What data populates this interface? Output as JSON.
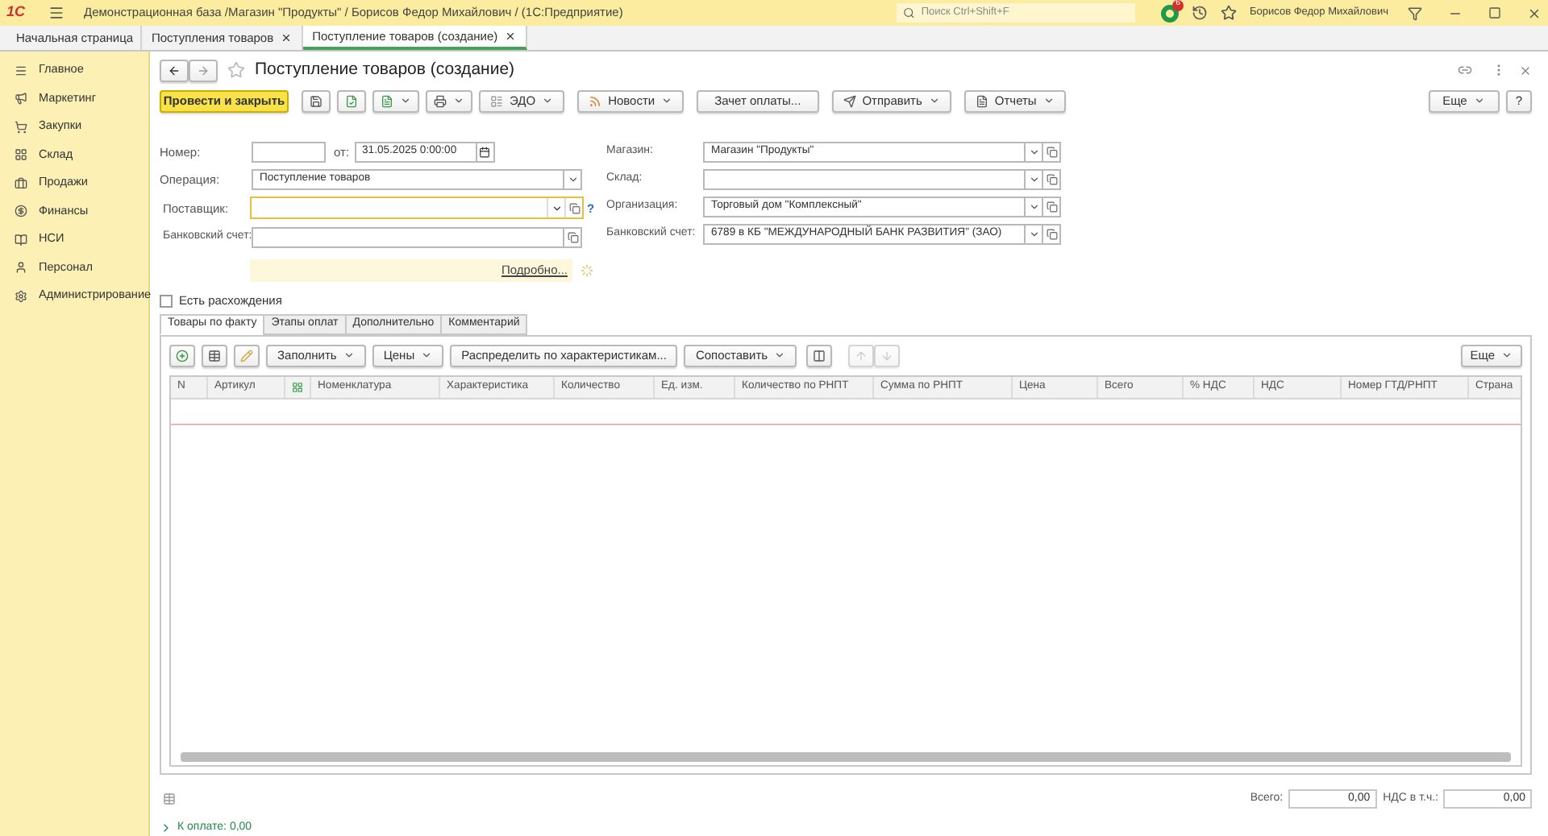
{
  "app_bar": {
    "logo": "1С",
    "title": "Демонстрационная база /Магазин \"Продукты\" / Борисов Федор Михайлович /  (1С:Предприятие)",
    "search_placeholder": "Поиск Ctrl+Shift+F",
    "notifications": "6",
    "user": "Борисов Федор Михайлович"
  },
  "open_tabs": [
    {
      "kind": "home",
      "label": "Начальная страница",
      "selected": false
    },
    {
      "kind": "closable",
      "label": "Поступления товаров",
      "selected": false
    },
    {
      "kind": "closable",
      "label": "Поступление товаров (создание)",
      "selected": true
    }
  ],
  "sidebar": {
    "items": [
      {
        "label": "Главное"
      },
      {
        "label": "Маркетинг"
      },
      {
        "label": "Закупки"
      },
      {
        "label": "Склад"
      },
      {
        "label": "Продажи"
      },
      {
        "label": "Финансы"
      },
      {
        "label": "НСИ"
      },
      {
        "label": "Персонал"
      },
      {
        "label": "Администрирование"
      }
    ]
  },
  "form": {
    "title": "Поступление товаров (создание)",
    "toolbar": [
      {
        "kind": "primary",
        "label": "Провести и закрыть"
      },
      {
        "kind": "icon"
      },
      {
        "kind": "icon"
      },
      {
        "kind": "icon_menu"
      },
      {
        "kind": "icon_menu"
      },
      {
        "kind": "icon_menu",
        "label": "ЭДО"
      },
      {
        "kind": "icon_menu",
        "label": "Новости"
      },
      {
        "kind": "button",
        "label": "Зачет оплаты..."
      },
      {
        "kind": "icon_menu",
        "label": "Отправить"
      },
      {
        "kind": "icon_menu",
        "label": "Отчеты"
      }
    ],
    "more": "Еще",
    "help": "?",
    "number": {
      "label": "Номер:"
    },
    "date": {
      "label": "от:",
      "value": "31.05.2025  0:00:00"
    },
    "operation": {
      "label": "Операция:",
      "value": "Поступление товаров"
    },
    "supplier": {
      "label": "Поставщик:",
      "hint": "?"
    },
    "bank_account": {
      "label": "Банковский счет:"
    },
    "details_link": "Подробно...",
    "right_fields": [
      {
        "label": "Магазин:",
        "value": "Магазин \"Продукты\""
      },
      {
        "label": "Склад:"
      },
      {
        "label": "Организация:",
        "value": "Торговый дом \"Комплексный\""
      },
      {
        "label": "Банковский счет:",
        "value": "6789 в КБ \"МЕЖДУНАРОДНЫЙ БАНК РАЗВИТИЯ\" (ЗАО)"
      }
    ],
    "discrepancy": {
      "label": "Есть расхождения",
      "checked": false
    },
    "tabs": [
      {
        "label": "Товары по факту",
        "selected": true
      },
      {
        "label": "Этапы оплат",
        "selected": false
      },
      {
        "label": "Дополнительно",
        "selected": false
      },
      {
        "label": "Комментарий",
        "selected": false
      }
    ],
    "table_toolbar": [
      {
        "kind": "icon"
      },
      {
        "kind": "icon"
      },
      {
        "kind": "icon"
      },
      {
        "kind": "menu",
        "label": "Заполнить"
      },
      {
        "kind": "menu",
        "label": "Цены"
      },
      {
        "kind": "button",
        "label": "Распределить по характеристикам..."
      },
      {
        "kind": "menu",
        "label": "Сопоставить"
      },
      {
        "kind": "icon"
      },
      {
        "kind": "arrows"
      }
    ],
    "table_more": "Еще",
    "columns": [
      {
        "kind": "text",
        "label": "N"
      },
      {
        "kind": "text",
        "label": "Артикул"
      },
      {
        "kind": "icon"
      },
      {
        "kind": "text",
        "label": "Номенклатура"
      },
      {
        "kind": "text",
        "label": "Характеристика"
      },
      {
        "kind": "text",
        "label": "Количество"
      },
      {
        "kind": "text",
        "label": "Ед. изм."
      },
      {
        "kind": "text",
        "label": "Количество по РНПТ"
      },
      {
        "kind": "text",
        "label": "Сумма по РНПТ"
      },
      {
        "kind": "text",
        "label": "Цена"
      },
      {
        "kind": "text",
        "label": "Всего"
      },
      {
        "kind": "text",
        "label": "% НДС"
      },
      {
        "kind": "text",
        "label": "НДС"
      },
      {
        "kind": "text",
        "label": "Номер ГТД/РНПТ"
      },
      {
        "kind": "text",
        "label": "Страна"
      }
    ],
    "totals": [
      {
        "label": "Всего:",
        "value": "0,00"
      },
      {
        "label": "НДС в т.ч.:",
        "value": "0,00"
      }
    ],
    "payment": {
      "label": "К оплате: 0,00",
      "expanded": false
    }
  }
}
